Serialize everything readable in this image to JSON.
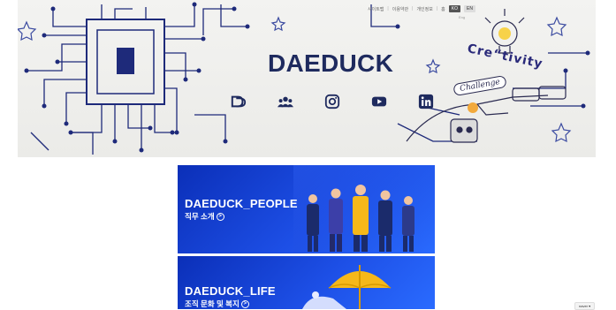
{
  "header": {
    "util_links": [
      "사이트맵",
      "이용약관",
      "개인정보",
      "홈"
    ],
    "lang_active": "KO",
    "lang_alt": "EN",
    "util_sub": "Eng"
  },
  "hero": {
    "brand": "DAEDUCK",
    "sticker": "Challenge",
    "creative": "Cre“tivity",
    "sns": [
      {
        "name": "daeduck-logo-icon"
      },
      {
        "name": "community-icon"
      },
      {
        "name": "instagram-icon"
      },
      {
        "name": "youtube-icon"
      },
      {
        "name": "linkedin-icon"
      }
    ]
  },
  "banners": {
    "people": {
      "title": "DAEDUCK_PEOPLE",
      "sub": "직무 소개",
      "arrow": ">"
    },
    "life": {
      "title": "DAEDUCK_LIFE",
      "sub": "조직 문화 및 복지",
      "arrow": ">"
    }
  },
  "footer": {
    "chip": "naver ▾"
  },
  "colors": {
    "brand": "#1e2a5e",
    "banner_blue": "#1d4fe6"
  }
}
